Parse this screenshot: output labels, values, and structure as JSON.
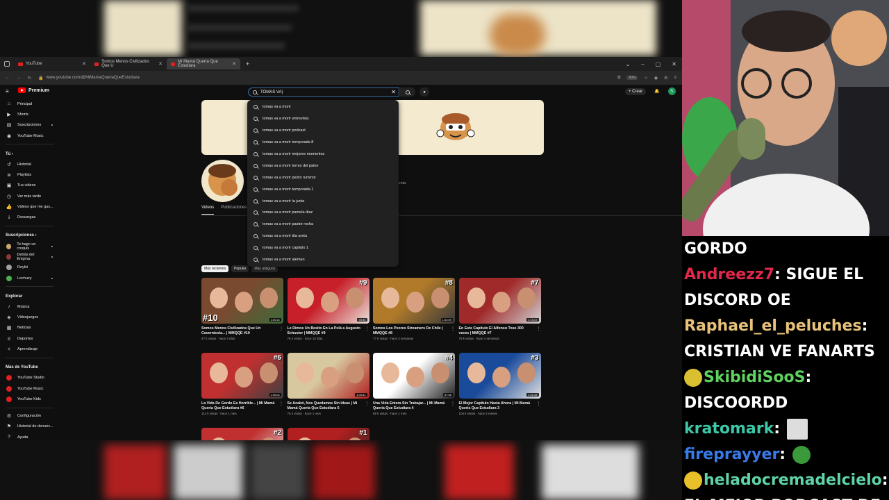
{
  "browser": {
    "tabs": [
      {
        "label": "YouTube",
        "active": false
      },
      {
        "label": "Somos Menos Civilizados Que U",
        "active": false
      },
      {
        "label": "Mi Mamá Quería Que Estudiara",
        "active": true
      }
    ],
    "url": "www.youtube.com/@MiMamaQueriaQueEstudiara",
    "zoom": "90%"
  },
  "youtube": {
    "logo": "Premium",
    "search_value": "TOMAS VA|",
    "create_label": "Crear",
    "avatar_letter": "S",
    "sidebar": {
      "main": [
        {
          "label": "Principal",
          "icon": "home-icon"
        },
        {
          "label": "Shorts",
          "icon": "shorts-icon"
        },
        {
          "label": "Suscripciones",
          "icon": "subscriptions-icon"
        },
        {
          "label": "YouTube Music",
          "icon": "music-icon"
        }
      ],
      "you_header": "Tú",
      "you": [
        {
          "label": "Historial",
          "icon": "history-icon"
        },
        {
          "label": "Playlists",
          "icon": "playlist-icon"
        },
        {
          "label": "Tus videos",
          "icon": "video-icon"
        },
        {
          "label": "Ver más tarde",
          "icon": "clock-icon"
        },
        {
          "label": "Videos que me gus...",
          "icon": "like-icon"
        },
        {
          "label": "Descargas",
          "icon": "download-icon"
        }
      ],
      "subs_header": "Suscripciones",
      "subs": [
        {
          "label": "Te hago un croquis",
          "color": "#c9a86b"
        },
        {
          "label": "Detrás del Enigma",
          "color": "#8b3a3a"
        },
        {
          "label": "Roykii",
          "color": "#a0a0a0"
        },
        {
          "label": "Lechuzy",
          "color": "#4caf50"
        }
      ],
      "explore_header": "Explorar",
      "explore": [
        {
          "label": "Música",
          "icon": "music-note-icon"
        },
        {
          "label": "Videojuegos",
          "icon": "gamepad-icon"
        },
        {
          "label": "Noticias",
          "icon": "news-icon"
        },
        {
          "label": "Deportes",
          "icon": "trophy-icon"
        },
        {
          "label": "Aprendizaje",
          "icon": "bulb-icon"
        }
      ],
      "more_header": "Más de YouTube",
      "more": [
        {
          "label": "YouTube Studio"
        },
        {
          "label": "YouTube Music"
        },
        {
          "label": "YouTube Kids"
        }
      ],
      "settings": [
        {
          "label": "Configuración",
          "icon": "gear-icon"
        },
        {
          "label": "Historial de denunc...",
          "icon": "flag-icon"
        },
        {
          "label": "Ayuda",
          "icon": "help-icon"
        }
      ]
    },
    "suggestions": [
      "tomas va a morir",
      "tomas va a morir entrevista",
      "tomas va a morir podcast",
      "tomas va a morir temporada 8",
      "tomas va a morir mejores momentos",
      "tomas va a morir torres del paine",
      "tomas va a morir pedro ruminot",
      "tomas va a morir temporada 1",
      "tomas va a morir la junta",
      "tomas va a morir pamela diaz",
      "tomas va a morir pastor rocha",
      "tomas va a morir tita ureta",
      "tomas va a morir capitulo 1",
      "tomas va a morir aleman"
    ],
    "channel_tabs": [
      "Videos",
      "Publicaciones"
    ],
    "more_link": "...más",
    "chips": [
      "Más recientes",
      "Popular",
      "Más antiguos"
    ],
    "videos": [
      {
        "title": "Somos Menos Civilizados Que Un Cavernícola... | MMQQE #10",
        "meta": "47 k vistas · hace 3 días",
        "duration": "1:00:21",
        "badge": "#10",
        "c1": "#7a4a30",
        "c2": "#3d6b3a"
      },
      {
        "title": "Le Dimos Un Besito En La Pelá a Augusto Schuster | MMQQE #9",
        "meta": "76 k vistas · hace 10 días",
        "duration": "59:55",
        "badge": "#9",
        "c1": "#c8202a",
        "c2": "#e8e0d8"
      },
      {
        "title": "Somos Los Peores Streamers De Chile | MMQQE #8",
        "meta": "77 k vistas · hace 2 semanas",
        "duration": "1:02:59",
        "badge": "#8",
        "c1": "#b07a2a",
        "c2": "#3a3a3a"
      },
      {
        "title": "En Este Capitulo El Alfonso Tose 300 veces | MMQQE #7",
        "meta": "75 k vistas · hace 3 semanas",
        "duration": "1:15:47",
        "badge": "#7",
        "c1": "#a02a2a",
        "c2": "#d0d0d0"
      },
      {
        "title": "La Vida De Gordo Es Horrible... | Mi Mamá Quería Que Estudiara #6",
        "meta": "112 k vistas · hace 1 mes",
        "duration": "1:06:01",
        "badge": "#6",
        "c1": "#c03030",
        "c2": "#404040"
      },
      {
        "title": "Se Acabó, Nos Quedamos Sin Ideas | Mi Mamá Quería Que Estudiara 5",
        "meta": "76 k vistas · hace 1 mes",
        "duration": "1:03:41",
        "badge": "",
        "c1": "#d8c8a0",
        "c2": "#b02020"
      },
      {
        "title": "Una Vida Entera Sin Trabajar... | Mi Mamá Quería Que Estudiara 4",
        "meta": "89 k vistas · hace 1 mes",
        "duration": "57:56",
        "badge": "#4",
        "c1": "#ffffff",
        "c2": "#202020"
      },
      {
        "title": "El Mejor Capitulo Hasta Ahora | Mi Mamá Quería Que Estudiara 3",
        "meta": "104 k vistas · hace 2 meses",
        "duration": "1:02:28",
        "badge": "#3",
        "c1": "#1a4a9a",
        "c2": "#e0e0e0"
      },
      {
        "title": "",
        "meta": "",
        "duration": "",
        "badge": "#2",
        "c1": "#c03030",
        "c2": "#e0e0e0"
      },
      {
        "title": "",
        "meta": "",
        "duration": "",
        "badge": "#1",
        "c1": "#b02020",
        "c2": "#222"
      }
    ]
  },
  "chat": [
    {
      "user": "",
      "text": "GORDO",
      "color": "#ffffff",
      "emote": false
    },
    {
      "user": "Andreezz7",
      "text": ": SIGUE EL",
      "color": "#e0284a",
      "emote": false
    },
    {
      "user": "",
      "text": "DISCORD OE",
      "color": "#ffffff",
      "emote": false
    },
    {
      "user": "Raphael_el_peluches",
      "text": ":",
      "color": "#e8c27a",
      "emote": false
    },
    {
      "user": "",
      "text": "CRISTIAN VE FANARTS",
      "color": "#ffffff",
      "emote": false
    },
    {
      "user": "SkibidiSooS",
      "text": ":",
      "color": "#5fd35f",
      "emote": true
    },
    {
      "user": "",
      "text": "DISCOORDD",
      "color": "#ffffff",
      "emote": false
    },
    {
      "user": "kratomark",
      "text": ":",
      "color": "#3cc8a8",
      "emote": false
    },
    {
      "user": "fireprayyer",
      "text": ":",
      "color": "#3a7ae8",
      "emote": false
    },
    {
      "user": "heladocremadelcielo",
      "text": ":",
      "color": "#5fd3a8",
      "emote": true
    },
    {
      "user": "",
      "text": "EL MEJOR PODCAST DE",
      "color": "#ffffff",
      "emote": false
    }
  ],
  "colors": {
    "accent": "#ff0000",
    "bg": "#0f0f0f"
  }
}
